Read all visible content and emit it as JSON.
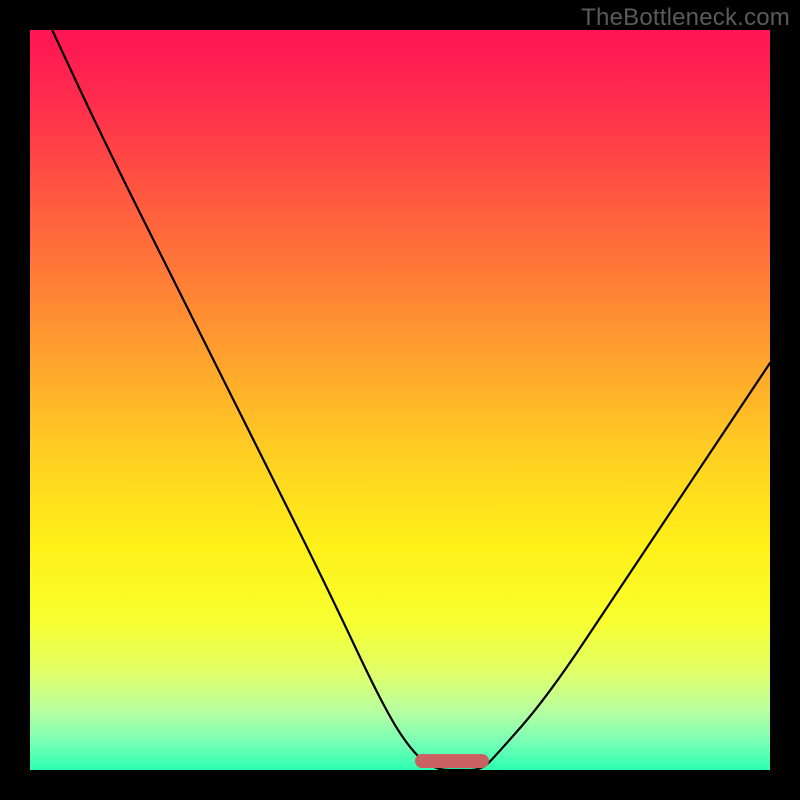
{
  "watermark": "TheBottleneck.com",
  "colors": {
    "black": "#000000",
    "curve": "#000000",
    "hump": "#c96160",
    "watermark_text": "#5a5a5a",
    "gradient_stops": [
      "#ff1455",
      "#ff2e4c",
      "#ff5740",
      "#ff7e36",
      "#ffa82c",
      "#ffd122",
      "#fff118",
      "#f7ff30",
      "#dfff6a",
      "#b8ffa0",
      "#7cffb5",
      "#2bffb0"
    ]
  },
  "chart_data": {
    "type": "line",
    "title": "",
    "xlabel": "",
    "ylabel": "",
    "xlim": [
      0,
      100
    ],
    "ylim": [
      0,
      100
    ],
    "x": [
      3,
      10,
      20,
      30,
      40,
      48,
      52,
      55,
      58,
      61,
      63,
      70,
      80,
      90,
      100
    ],
    "values": [
      100,
      85,
      65,
      45,
      25,
      8,
      2,
      0,
      0,
      0,
      2,
      10,
      25,
      40,
      55
    ],
    "flat_bottom": {
      "x_start": 52,
      "x_end": 62,
      "y": 0
    },
    "gradient_axis": "y",
    "gradient_meaning": "value of curve — red high, green low"
  }
}
